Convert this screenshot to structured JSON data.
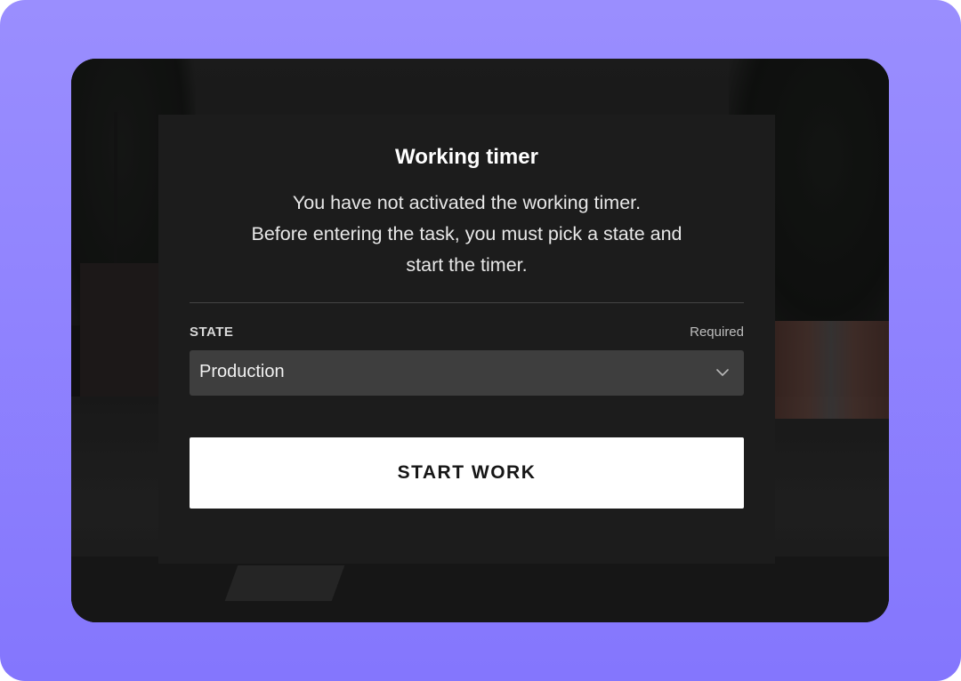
{
  "dialog": {
    "title": "Working timer",
    "message_lines": [
      "You have not activated the working timer.",
      "Before entering the task, you must pick a state and",
      "start the timer."
    ]
  },
  "state_field": {
    "label": "STATE",
    "required_text": "Required",
    "selected_value": "Production",
    "chevron_icon": "chevron-down-icon"
  },
  "actions": {
    "start_label": "START WORK"
  },
  "colors": {
    "outer_background": "#8f82fe",
    "dialog_background": "#1c1c1c",
    "select_background": "#3e3e3e",
    "button_background": "#ffffff",
    "button_text": "#161616"
  }
}
